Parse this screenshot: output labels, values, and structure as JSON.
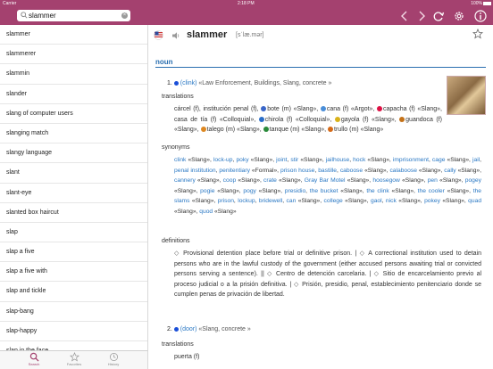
{
  "status": {
    "carrier": "Carrier",
    "time": "2:18 PM",
    "battery": "100%"
  },
  "search": {
    "value": "slammer",
    "placeholder": ""
  },
  "list": [
    "slammer",
    "slammerer",
    "slammin",
    "slander",
    "slang of computer users",
    "slanging match",
    "slangy language",
    "slant",
    "slant-eye",
    "slanted box haircut",
    "slap",
    "slap a five",
    "slap a five with",
    "slap and tickle",
    "slap-bang",
    "slap-happy",
    "slap in the face"
  ],
  "tabs": [
    {
      "label": "Search",
      "icon": "search-icon"
    },
    {
      "label": "Favorites",
      "icon": "star-icon"
    },
    {
      "label": "History",
      "icon": "clock-icon"
    }
  ],
  "entry": {
    "headword": "slammer",
    "phonetic": "[sˈlæ.mər]",
    "pos": "noun",
    "sense1": {
      "num": "1.",
      "word": "(clink)",
      "labels": "«Law Enforcement, Buildings, Slang, concrete »",
      "translations_heading": "translations",
      "translations_line1": "cárcel (f), institución penal (f),",
      "translations_line1b": "bote (m) «Slang»,",
      "translations_line1c": "cana (f) «Argot»,",
      "translations_line1d": "capacha",
      "translations_line2": "(f) «Slang», casa de tía (f) «Colloquial»,",
      "translations_line2b": "chirola (f) «Colloquial»,",
      "translations_line2c": "gayola (f) «Slang»,",
      "translations_line3": "guandoca (f) «Slang»,",
      "translations_line3b": "talego (m) «Slang»,",
      "translations_line3c": "tanque (m) «Slang»,",
      "translations_line3d": "trullo (m) «Slang»",
      "synonyms_heading": "synonyms",
      "definitions_heading": "definitions",
      "def1": "Provisional detention place before trial or definitive prison. |",
      "def1b": "A correctional institution used to detain persons who are in the lawful custody of the government (either accused persons awaiting trial or convicted persons serving a sentence). ||",
      "def1c": "Centro de detención carcelaria. |",
      "def1d": "Sitio de encarcelamiento previo al proceso judicial o a la prisión definitiva. |",
      "def1e": "Prisión, presidio, penal, establecimiento penitenciario donde se cumplen penas de privación de libertad."
    },
    "sense2": {
      "num": "2.",
      "word": "(door)",
      "labels": "«Slang, concrete »",
      "translations_heading": "translations",
      "translation": "puerta (f)"
    }
  },
  "colors": {
    "brand": "#a4416f",
    "link": "#2a78c4"
  }
}
